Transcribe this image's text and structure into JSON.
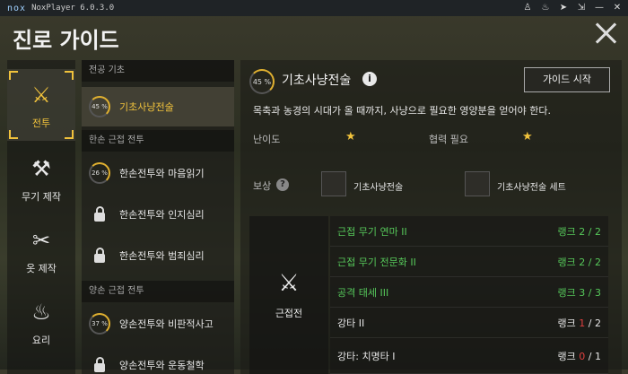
{
  "emulator": {
    "logo": "nox",
    "title": "NoxPlayer 6.0.3.0",
    "controls": [
      "shirt-icon",
      "bell-icon",
      "pin-icon",
      "restore-icon",
      "minimize-icon",
      "close-icon"
    ]
  },
  "header": {
    "title": "진로 가이드"
  },
  "categories": [
    {
      "label": "전투",
      "icon": "sword-icon",
      "active": true
    },
    {
      "label": "무기 제작",
      "icon": "anvil-icon",
      "active": false
    },
    {
      "label": "옷 제작",
      "icon": "scissors-icon",
      "active": false
    },
    {
      "label": "요리",
      "icon": "cooking-icon",
      "active": false
    }
  ],
  "list": {
    "groups": [
      {
        "title": "전공 기초"
      },
      {
        "title": "한손 근접 전투"
      },
      {
        "title": "양손 근접 전투"
      }
    ],
    "items": [
      {
        "name": "기초사냥전술",
        "progress": "45 %",
        "locked": false,
        "selected": true
      },
      {
        "name": "한손전투와 마음읽기",
        "progress": "26 %",
        "locked": false,
        "selected": false
      },
      {
        "name": "한손전투와 인지심리",
        "progress": "",
        "locked": true,
        "selected": false
      },
      {
        "name": "한손전투와 범죄심리",
        "progress": "",
        "locked": true,
        "selected": false
      },
      {
        "name": "양손전투와 비판적사고",
        "progress": "37 %",
        "locked": false,
        "selected": false
      },
      {
        "name": "양손전투와 운동철학",
        "progress": "",
        "locked": true,
        "selected": false
      }
    ]
  },
  "detail": {
    "progress": "45 %",
    "title": "기초사냥전술",
    "guide_button": "가이드 시작",
    "description": "목축과 농경의 시대가 올 때까지, 사냥으로 필요한 영양분을 얻어야 한다.",
    "difficulty_label": "난이도",
    "coop_label": "협력 필요",
    "reward_label": "보상",
    "rewards": [
      {
        "name": "기초사냥전술",
        "icon": "title-badge-icon"
      },
      {
        "name": "기초사냥전술 세트",
        "icon": "box-icon"
      }
    ],
    "skill_category": "근접전",
    "skills": [
      {
        "name": "근접 무기 연마 II",
        "rank_label": "랭크",
        "current": "2",
        "max": "2",
        "complete": true
      },
      {
        "name": "근접 무기 전문화 II",
        "rank_label": "랭크",
        "current": "2",
        "max": "2",
        "complete": true
      },
      {
        "name": "공격 태세 III",
        "rank_label": "랭크",
        "current": "3",
        "max": "3",
        "complete": true
      },
      {
        "name": "강타 II",
        "rank_label": "랭크",
        "current": "1",
        "max": "2",
        "complete": false
      },
      {
        "name": "강타: 치명타 I",
        "rank_label": "랭크",
        "current": "0",
        "max": "1",
        "complete": false
      }
    ]
  },
  "colors": {
    "accent": "#f0c23c",
    "complete": "#56c85a",
    "incomplete": "#e04040"
  }
}
